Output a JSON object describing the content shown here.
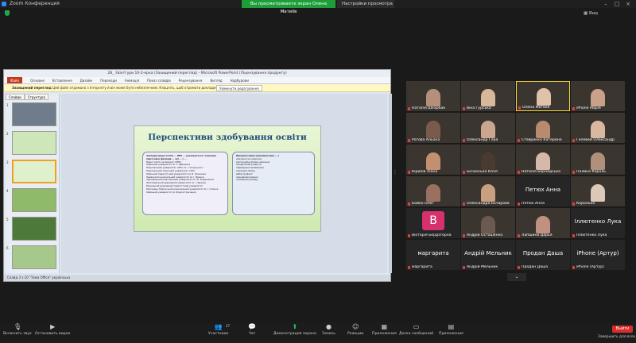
{
  "titlebar": {
    "app_title": "Zoom Конференция",
    "share_banner": "Вы просматриваете экран Олена Матвіїв",
    "view_options": "Настройки просмотра",
    "view_label": "Вид"
  },
  "ppt": {
    "window_title": "28_ Заїнтгури 10-2-ерка (Захищений перегляд) - Microsoft PowerPoint (Ліцензування продукту)",
    "ribbon_tabs": [
      "Файл",
      "Основне",
      "Вставлення",
      "Дизайн",
      "Переходи",
      "Анімація",
      "Показ слайдів",
      "Рецензування",
      "Вигляд",
      "Надбудови"
    ],
    "warning_label": "Захищений перегляд",
    "warning_text": "Цей файл отримано з Інтернету й він може бути небезпечним. Клацніть, щоб отримати докладніші відомості.",
    "edit_button": "Увімкнути редагування",
    "left_tabs": [
      "Слайди",
      "Структура"
    ],
    "slide_numbers": [
      "1",
      "2",
      "3",
      "4",
      "5",
      "6"
    ],
    "slide": {
      "title": "Перспективи здобування освіти",
      "left_heading": "Заклади вищої освіти ... ВНЗ ... реалізуються ступенева підготовка фахівців ... які ... і ...",
      "left_items": [
        "Вищої освіти на бюджеті (ЗВО)",
        "Київський університет ім. Т. Шевченка",
        "Національний університет «КПІ» ім. І. Сікорського",
        "Національний технічний університет «ХПІ»",
        "Київський педагогічний університет ім. Б. Грінченка",
        "Львівський національний університет ім. І. Франка",
        "Чернівецький національний університет ім. Ю. Федьковича",
        "Житомирський державний університет ім. І. Франка",
        "Вінницький державний педагогічний університет",
        "Кам'янець-Подільський національний університет ім. І. Огієнка",
        "Київський університет ім. Бориса Грінченка"
      ],
      "right_heading": "Пріоритетними можливостями ... є",
      "right_items": [
        "навчання за кордоном",
        "дистанційна форма навчання",
        "професійний розвиток",
        "підвищення кваліфікації",
        "програми обміну",
        "вибір професії",
        "працевлаштування",
        "отримання досвіду"
      ]
    },
    "status_bar": "Слайд 3 з 20   \"Тема Office\"   українська"
  },
  "gallery": [
    {
      "name": "Наталія Шкарбан",
      "type": "video",
      "skin": "#b58f7c"
    },
    {
      "name": "Вiкa Гурська",
      "type": "video",
      "skin": "#d8b89a"
    },
    {
      "name": "Олена Матвіїв",
      "type": "video",
      "skin": "#e0c2a8",
      "active": true
    },
    {
      "name": "iPhone Марія",
      "type": "video",
      "skin": "#c9a08a"
    },
    {
      "name": "Рогова Альона",
      "type": "video",
      "skin": "#7a5a4a"
    },
    {
      "name": "Олександр Гера",
      "type": "video",
      "skin": "#caa58f"
    },
    {
      "name": "Ставринко Катерина",
      "type": "video",
      "skin": "#b88a6e"
    },
    {
      "name": "Гелевей Олександр",
      "type": "video",
      "skin": "#d9b8a0"
    },
    {
      "name": "Кірилів Ліана",
      "type": "video",
      "skin": "#c29070"
    },
    {
      "name": "Бочанська Юлія",
      "type": "video",
      "skin": "#4a3a30"
    },
    {
      "name": "Наталія Бернадська",
      "type": "video",
      "skin": "#d4b8a8"
    },
    {
      "name": "Полина Король",
      "type": "video",
      "skin": "#b0907a"
    },
    {
      "name": "Бойко Олег",
      "type": "video",
      "skin": "#9a7060"
    },
    {
      "name": "Олександра Бочарова",
      "type": "video",
      "skin": "#c8a080"
    },
    {
      "name": "Петюх Анна",
      "type": "name"
    },
    {
      "name": "Королька",
      "type": "video",
      "skin": "#dcc8b8"
    },
    {
      "name": "Вікторія Бердзгорна",
      "type": "avatar",
      "letter": "В"
    },
    {
      "name": "Андрій Осташенко",
      "type": "video",
      "skin": "#6a5a50"
    },
    {
      "name": "Лапшина Дарья",
      "type": "video",
      "skin": "#c09080"
    },
    {
      "name": "Іллютенко Лука",
      "type": "name"
    },
    {
      "name": "маргарита",
      "type": "name"
    },
    {
      "name": "Андрій Мельник",
      "type": "name"
    },
    {
      "name": "Продан Даша",
      "type": "name"
    },
    {
      "name": "iPhone (Артур)",
      "type": "name"
    }
  ],
  "toolbar": {
    "items": [
      {
        "label": "Включить звук",
        "icon": "microphone-icon"
      },
      {
        "label": "Остановить видео",
        "icon": "video-camera-icon"
      },
      {
        "label": "Участники",
        "icon": "participants-icon",
        "count": "27"
      },
      {
        "label": "Чат",
        "icon": "chat-icon"
      },
      {
        "label": "Демонстрация экрана",
        "icon": "share-screen-icon"
      },
      {
        "label": "Запись",
        "icon": "record-icon"
      },
      {
        "label": "Реакции",
        "icon": "reactions-icon"
      },
      {
        "label": "Приложения",
        "icon": "apps-icon"
      },
      {
        "label": "Доска сообщений",
        "icon": "whiteboard-icon"
      },
      {
        "label": "Приложения",
        "icon": "notes-icon"
      }
    ],
    "leave": "Выйти",
    "leave_sub": "Завершить для всех"
  },
  "colors": {
    "share_banner": "#1e9e38",
    "active_speaker": "#f5d43a",
    "leave": "#d92c2c",
    "slide_title": "#1f4a7a"
  }
}
